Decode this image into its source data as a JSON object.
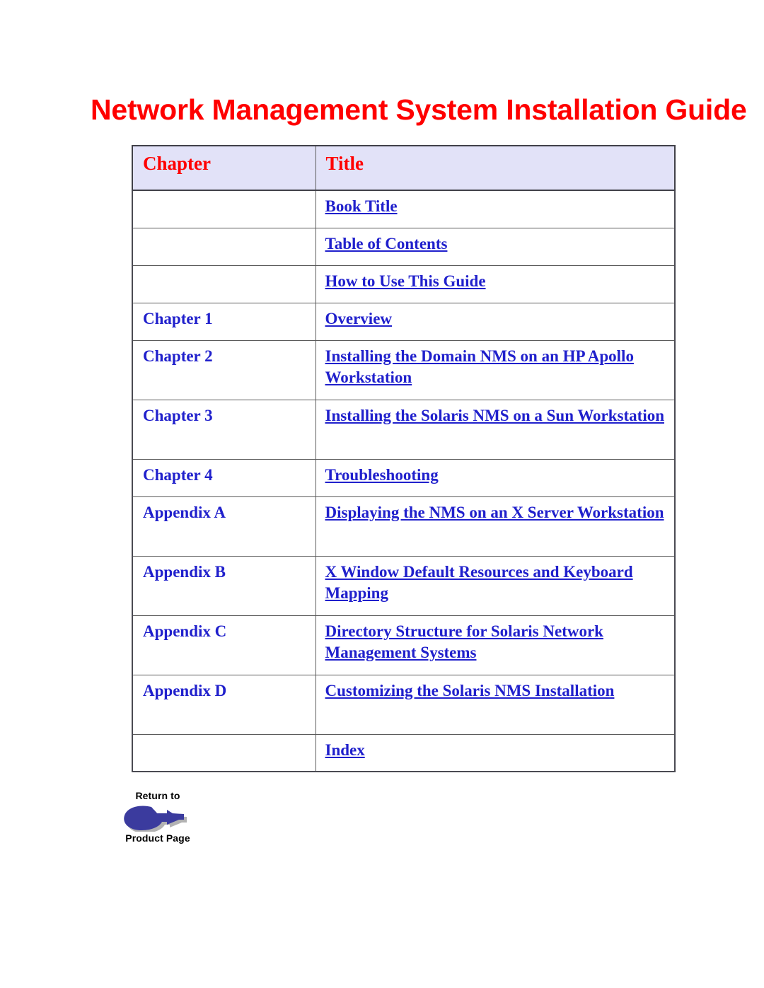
{
  "document": {
    "title": "Network Management System Installation Guide",
    "title_color": "#ff0000",
    "link_color": "#2020cc",
    "header_bg_color": "#e2e2f8"
  },
  "toc_table": {
    "headers": {
      "chapter": "Chapter",
      "title": "Title"
    },
    "rows": [
      {
        "chapter": "",
        "title": "Book Title"
      },
      {
        "chapter": "",
        "title": "Table of Contents"
      },
      {
        "chapter": "",
        "title": "How to Use This Guide"
      },
      {
        "chapter": "Chapter 1",
        "title": "Overview"
      },
      {
        "chapter": "Chapter 2",
        "title": "Installing the Domain NMS on an HP Apollo Workstation"
      },
      {
        "chapter": "Chapter 3",
        "title": "Installing the Solaris NMS on a Sun Workstation"
      },
      {
        "chapter": "Chapter 4",
        "title": "Troubleshooting"
      },
      {
        "chapter": "Appendix A",
        "title": "Displaying the NMS on an X Server Workstation"
      },
      {
        "chapter": "Appendix B",
        "title": "X Window Default Resources and Keyboard Mapping"
      },
      {
        "chapter": "Appendix C",
        "title": "Directory Structure for Solaris Network Management Systems"
      },
      {
        "chapter": "Appendix D",
        "title": "Customizing the Solaris NMS Installation"
      },
      {
        "chapter": "",
        "title": "Index"
      }
    ]
  },
  "return_button": {
    "line1": "Return to",
    "line2": "Product Page",
    "icon": "pointing-hand-icon",
    "icon_color": "#3b3b9e"
  }
}
